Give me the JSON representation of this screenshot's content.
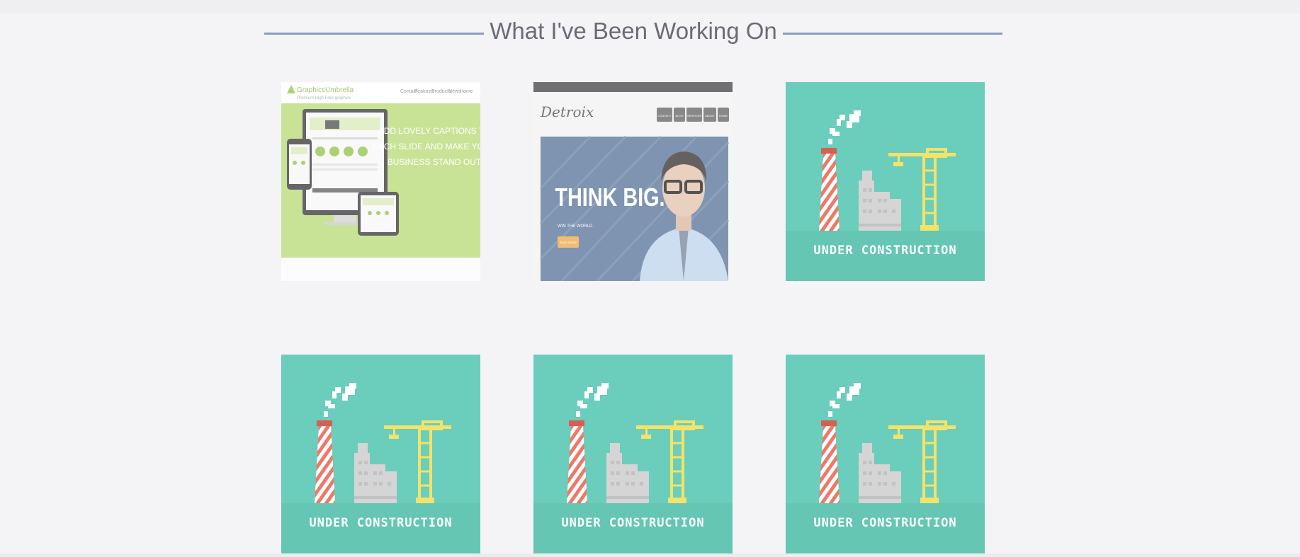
{
  "section": {
    "title": "What I've Been Working On"
  },
  "colors": {
    "background": "#f4f4f7",
    "rule": "#8b9cbb",
    "title": "#6b6b76",
    "construction_teal": "#6bcdbb",
    "crane_yellow": "#f3e36a",
    "chimney_red": "#e77565"
  },
  "projects": [
    {
      "kind": "screenshot",
      "brand": "GraphicsUmbrella",
      "tagline": "Premium High Free graphics",
      "nav": [
        "Contact",
        "Features",
        "Products",
        "News",
        "Home"
      ],
      "headline": [
        "ADD LOVELY CAPTIONS TO",
        "EACH SLIDE AND MAKE YOUR",
        "BUSINESS STAND OUT"
      ]
    },
    {
      "kind": "screenshot",
      "brand": "Detroix",
      "nav": [
        "CONTACT",
        "BLOG",
        "SERVICES",
        "ABOUT",
        "HOME"
      ],
      "headline": "THINK BIG.",
      "subline": "WIN THE WORLD.",
      "cta": "READ MORE"
    },
    {
      "kind": "placeholder",
      "caption": "UNDER CONSTRUCTION"
    },
    {
      "kind": "placeholder",
      "caption": "UNDER CONSTRUCTION"
    },
    {
      "kind": "placeholder",
      "caption": "UNDER CONSTRUCTION"
    },
    {
      "kind": "placeholder",
      "caption": "UNDER CONSTRUCTION"
    }
  ]
}
